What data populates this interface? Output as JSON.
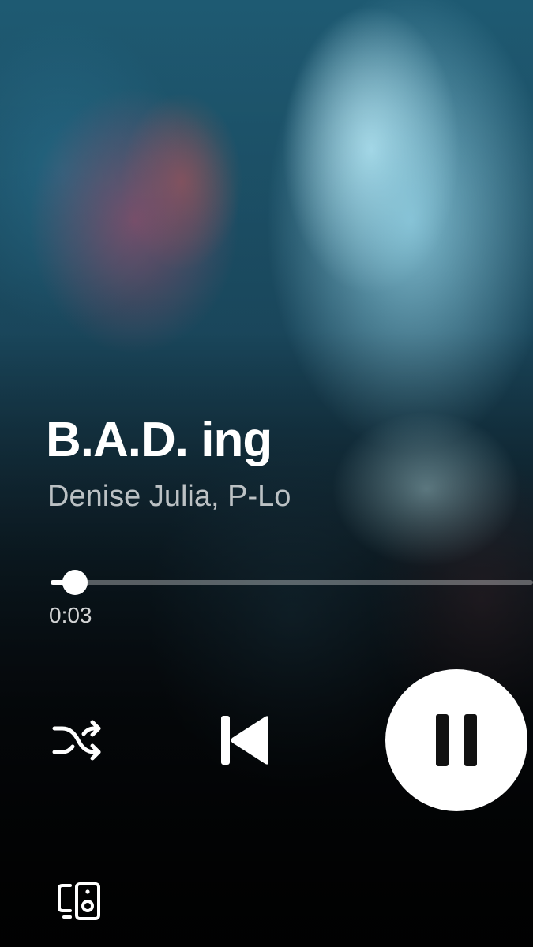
{
  "track": {
    "title": "B.A.D. ing",
    "artists": "Denise Julia, P-Lo"
  },
  "playback": {
    "elapsed": "0:03",
    "progress_fraction": 0.05,
    "state": "playing"
  },
  "controls": {
    "shuffle_icon": "shuffle-icon",
    "previous_icon": "skip-previous-icon",
    "pause_icon": "pause-icon",
    "devices_icon": "connect-devices-icon"
  },
  "colors": {
    "text_primary": "#ffffff",
    "text_secondary": "#b8bcbf",
    "accent_button": "#ffffff"
  }
}
